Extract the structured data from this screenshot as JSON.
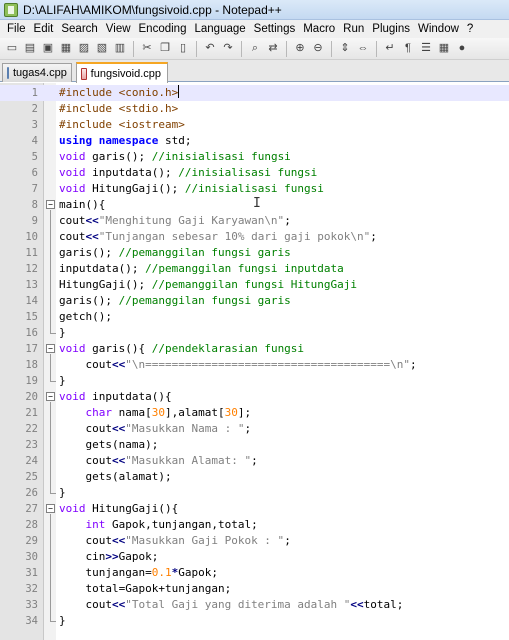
{
  "window": {
    "title": "D:\\ALIFAH\\AMIKOM\\fungsivoid.cpp - Notepad++"
  },
  "menu": [
    "File",
    "Edit",
    "Search",
    "View",
    "Encoding",
    "Language",
    "Settings",
    "Macro",
    "Run",
    "Plugins",
    "Window",
    "?"
  ],
  "toolbar": {
    "buttons": [
      {
        "name": "new-file-icon",
        "glyph": "▭"
      },
      {
        "name": "open-file-icon",
        "glyph": "▤"
      },
      {
        "name": "save-icon",
        "glyph": "▣"
      },
      {
        "name": "save-all-icon",
        "glyph": "▦"
      },
      {
        "name": "close-icon",
        "glyph": "▨"
      },
      {
        "name": "close-all-icon",
        "glyph": "▧"
      },
      {
        "name": "print-icon",
        "glyph": "▥"
      },
      {
        "sep": true
      },
      {
        "name": "cut-icon",
        "glyph": "✂"
      },
      {
        "name": "copy-icon",
        "glyph": "❐"
      },
      {
        "name": "paste-icon",
        "glyph": "▯"
      },
      {
        "sep": true
      },
      {
        "name": "undo-icon",
        "glyph": "↶"
      },
      {
        "name": "redo-icon",
        "glyph": "↷"
      },
      {
        "sep": true
      },
      {
        "name": "find-icon",
        "glyph": "⌕"
      },
      {
        "name": "replace-icon",
        "glyph": "⇄"
      },
      {
        "sep": true
      },
      {
        "name": "zoom-in-icon",
        "glyph": "⊕"
      },
      {
        "name": "zoom-out-icon",
        "glyph": "⊖"
      },
      {
        "sep": true
      },
      {
        "name": "sync-vertical-icon",
        "glyph": "⇕"
      },
      {
        "name": "sync-horizontal-icon",
        "glyph": "⇔"
      },
      {
        "sep": true
      },
      {
        "name": "word-wrap-icon",
        "glyph": "↵"
      },
      {
        "name": "show-all-chars-icon",
        "glyph": "¶"
      },
      {
        "name": "indent-guide-icon",
        "glyph": "☰"
      },
      {
        "name": "doc-map-icon",
        "glyph": "▦"
      },
      {
        "name": "record-macro-icon",
        "glyph": "●"
      }
    ]
  },
  "tabs": [
    {
      "label": "tugas4.cpp",
      "active": false
    },
    {
      "label": "fungsivoid.cpp",
      "active": true
    }
  ],
  "editor": {
    "current_line": 1,
    "lines": [
      {
        "n": "1",
        "tokens": [
          [
            "pre",
            "#include <conio.h>"
          ]
        ]
      },
      {
        "n": "2",
        "tokens": [
          [
            "pre",
            "#include <stdio.h>"
          ]
        ]
      },
      {
        "n": "3",
        "tokens": [
          [
            "pre",
            "#include <iostream>"
          ]
        ]
      },
      {
        "n": "4",
        "tokens": [
          [
            "kw",
            "using"
          ],
          [
            "plain",
            " "
          ],
          [
            "kw",
            "namespace"
          ],
          [
            "plain",
            " std;"
          ]
        ]
      },
      {
        "n": "5",
        "tokens": [
          [
            "type",
            "void"
          ],
          [
            "plain",
            " garis(); "
          ],
          [
            "cm",
            "//inisialisasi fungsi"
          ]
        ]
      },
      {
        "n": "6",
        "tokens": [
          [
            "type",
            "void"
          ],
          [
            "plain",
            " inputdata(); "
          ],
          [
            "cm",
            "//inisialisasi fungsi"
          ]
        ]
      },
      {
        "n": "7",
        "tokens": [
          [
            "type",
            "void"
          ],
          [
            "plain",
            " HitungGaji(); "
          ],
          [
            "cm",
            "//inisialisasi fungsi"
          ]
        ]
      },
      {
        "n": "8",
        "fold": "start",
        "tokens": [
          [
            "plain",
            "main(){"
          ]
        ]
      },
      {
        "n": "9",
        "tokens": [
          [
            "plain",
            "cout"
          ],
          [
            "op",
            "<<"
          ],
          [
            "str",
            "\"Menghitung Gaji Karyawan\\n\""
          ],
          [
            "plain",
            ";"
          ]
        ]
      },
      {
        "n": "10",
        "tokens": [
          [
            "plain",
            "cout"
          ],
          [
            "op",
            "<<"
          ],
          [
            "str",
            "\"Tunjangan sebesar 10% dari gaji pokok\\n\""
          ],
          [
            "plain",
            ";"
          ]
        ]
      },
      {
        "n": "11",
        "tokens": [
          [
            "plain",
            "garis(); "
          ],
          [
            "cm",
            "//pemanggilan fungsi garis"
          ]
        ]
      },
      {
        "n": "12",
        "tokens": [
          [
            "plain",
            "inputdata(); "
          ],
          [
            "cm",
            "//pemanggilan fungsi inputdata"
          ]
        ]
      },
      {
        "n": "13",
        "tokens": [
          [
            "plain",
            "HitungGaji(); "
          ],
          [
            "cm",
            "//pemanggilan fungsi HitungGaji"
          ]
        ]
      },
      {
        "n": "14",
        "tokens": [
          [
            "plain",
            "garis(); "
          ],
          [
            "cm",
            "//pemanggilan fungsi garis"
          ]
        ]
      },
      {
        "n": "15",
        "tokens": [
          [
            "plain",
            "getch();"
          ]
        ]
      },
      {
        "n": "16",
        "fold": "end",
        "tokens": [
          [
            "plain",
            "}"
          ]
        ]
      },
      {
        "n": "17",
        "fold": "start",
        "tokens": [
          [
            "type",
            "void"
          ],
          [
            "plain",
            " garis(){ "
          ],
          [
            "cm",
            "//pendeklarasian fungsi"
          ]
        ]
      },
      {
        "n": "18",
        "tokens": [
          [
            "plain",
            "    cout"
          ],
          [
            "op",
            "<<"
          ],
          [
            "str",
            "\"\\n=====================================\\n\""
          ],
          [
            "plain",
            ";"
          ]
        ]
      },
      {
        "n": "19",
        "fold": "end",
        "tokens": [
          [
            "plain",
            "}"
          ]
        ]
      },
      {
        "n": "20",
        "fold": "start",
        "tokens": [
          [
            "type",
            "void"
          ],
          [
            "plain",
            " inputdata(){"
          ]
        ]
      },
      {
        "n": "21",
        "tokens": [
          [
            "plain",
            "    "
          ],
          [
            "type",
            "char"
          ],
          [
            "plain",
            " nama["
          ],
          [
            "num",
            "30"
          ],
          [
            "plain",
            "],alamat["
          ],
          [
            "num",
            "30"
          ],
          [
            "plain",
            "];"
          ]
        ]
      },
      {
        "n": "22",
        "tokens": [
          [
            "plain",
            "    cout"
          ],
          [
            "op",
            "<<"
          ],
          [
            "str",
            "\"Masukkan Nama : \""
          ],
          [
            "plain",
            ";"
          ]
        ]
      },
      {
        "n": "23",
        "tokens": [
          [
            "plain",
            "    gets(nama);"
          ]
        ]
      },
      {
        "n": "24",
        "tokens": [
          [
            "plain",
            "    cout"
          ],
          [
            "op",
            "<<"
          ],
          [
            "str",
            "\"Masukkan Alamat: \""
          ],
          [
            "plain",
            ";"
          ]
        ]
      },
      {
        "n": "25",
        "tokens": [
          [
            "plain",
            "    gets(alamat);"
          ]
        ]
      },
      {
        "n": "26",
        "fold": "end",
        "tokens": [
          [
            "plain",
            "}"
          ]
        ]
      },
      {
        "n": "27",
        "fold": "start",
        "tokens": [
          [
            "type",
            "void"
          ],
          [
            "plain",
            " HitungGaji(){"
          ]
        ]
      },
      {
        "n": "28",
        "tokens": [
          [
            "plain",
            "    "
          ],
          [
            "type",
            "int"
          ],
          [
            "plain",
            " Gapok,tunjangan,total;"
          ]
        ]
      },
      {
        "n": "29",
        "tokens": [
          [
            "plain",
            "    cout"
          ],
          [
            "op",
            "<<"
          ],
          [
            "str",
            "\"Masukkan Gaji Pokok : \""
          ],
          [
            "plain",
            ";"
          ]
        ]
      },
      {
        "n": "30",
        "tokens": [
          [
            "plain",
            "    cin"
          ],
          [
            "op",
            ">>"
          ],
          [
            "plain",
            "Gapok;"
          ]
        ]
      },
      {
        "n": "31",
        "tokens": [
          [
            "plain",
            "    tunjangan="
          ],
          [
            "num",
            "0.1"
          ],
          [
            "op",
            "*"
          ],
          [
            "plain",
            "Gapok;"
          ]
        ]
      },
      {
        "n": "32",
        "tokens": [
          [
            "plain",
            "    total=Gapok+tunjangan;"
          ]
        ]
      },
      {
        "n": "33",
        "tokens": [
          [
            "plain",
            "    cout"
          ],
          [
            "op",
            "<<"
          ],
          [
            "str",
            "\"Total Gaji yang diterima adalah \""
          ],
          [
            "op",
            "<<"
          ],
          [
            "plain",
            "total;"
          ]
        ]
      },
      {
        "n": "34",
        "fold": "end",
        "tokens": [
          [
            "plain",
            "}"
          ]
        ]
      }
    ]
  },
  "icons": {
    "fold_open": "−",
    "mouse_cursor": "I"
  }
}
